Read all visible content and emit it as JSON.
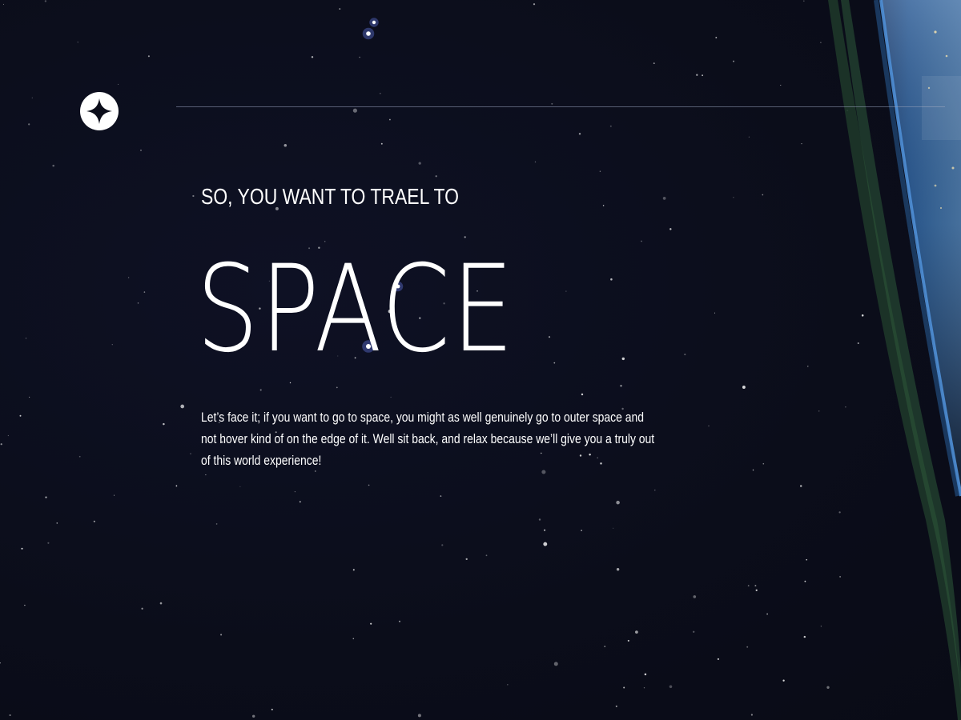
{
  "header": {
    "logo_icon": "four-point-star-icon"
  },
  "hero": {
    "subtitle": "SO, YOU WANT TO TRAEL TO",
    "title": "SPACE",
    "description": "Let’s face it; if you want to go to space, you might as well genuinely go to outer space and not hover kind of on the edge of it. Well sit back, and relax because we’ll give you a truly out of this world experience!"
  },
  "colors": {
    "background": "#0b0d1a",
    "text": "#ffffff",
    "divider": "#969fb9",
    "atmosphere": "#2f6fb3"
  }
}
